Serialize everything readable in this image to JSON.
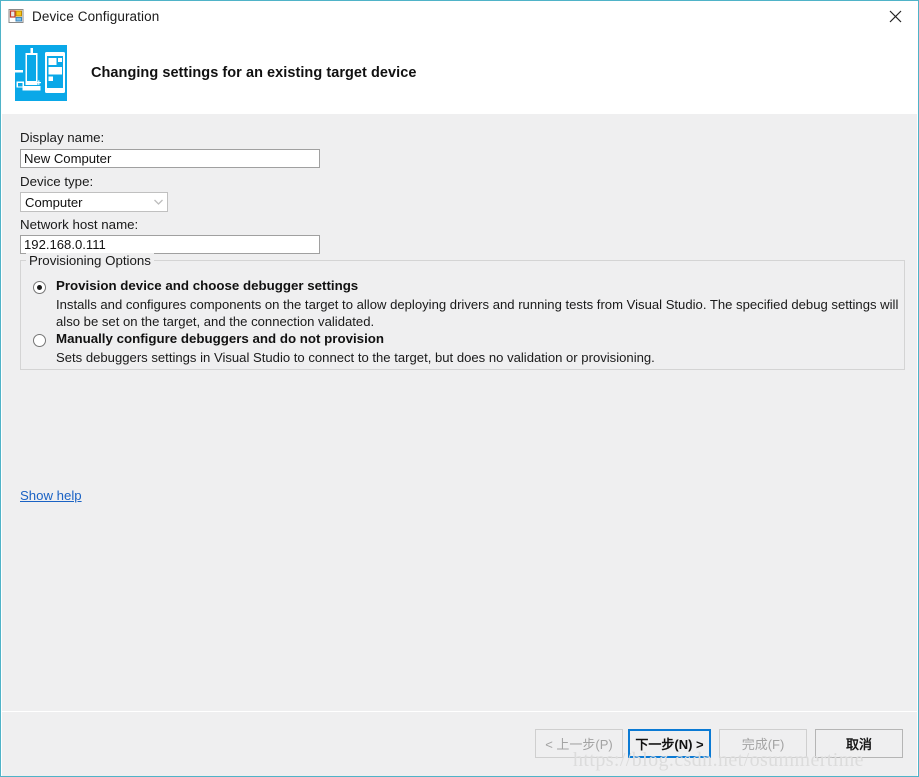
{
  "window": {
    "title": "Device Configuration",
    "app_icon": "vs-form-icon",
    "close_icon": "close-icon",
    "border_color": "#4fb3c8"
  },
  "header": {
    "icon": "device-pair-icon",
    "icon_color": "#0aa8e8",
    "title": "Changing settings for an existing target device"
  },
  "form": {
    "display_name": {
      "label": "Display name:",
      "value": "New Computer",
      "placeholder": ""
    },
    "device_type": {
      "label": "Device type:",
      "value": "Computer",
      "options": [
        "Computer"
      ],
      "arrow_icon": "chevron-down-icon"
    },
    "network_host_name": {
      "label": "Network host name:",
      "value": "192.168.0.111",
      "placeholder": ""
    }
  },
  "provisioning": {
    "legend": "Provisioning Options",
    "options": [
      {
        "title": "Provision device and choose debugger settings",
        "description": "Installs and configures components on the target to allow deploying drivers and running tests from Visual Studio. The specified debug settings will also be set on the target, and the connection validated.",
        "selected": true
      },
      {
        "title": "Manually configure debuggers and do not provision",
        "description": "Sets debuggers settings in Visual Studio to connect to the target, but does no validation or provisioning.",
        "selected": false
      }
    ]
  },
  "help": {
    "link_label": "Show help"
  },
  "footer": {
    "buttons": [
      {
        "label": "< 上一步(P)",
        "state": "disabled",
        "name": "back-button"
      },
      {
        "label": "下一步(N) >",
        "state": "default",
        "name": "next-button"
      },
      {
        "label": "完成(F)",
        "state": "disabled",
        "name": "finish-button"
      },
      {
        "label": "取消",
        "state": "normal",
        "name": "cancel-button"
      }
    ]
  },
  "watermark": {
    "text": "https://blog.csdn.net/osummertime"
  }
}
